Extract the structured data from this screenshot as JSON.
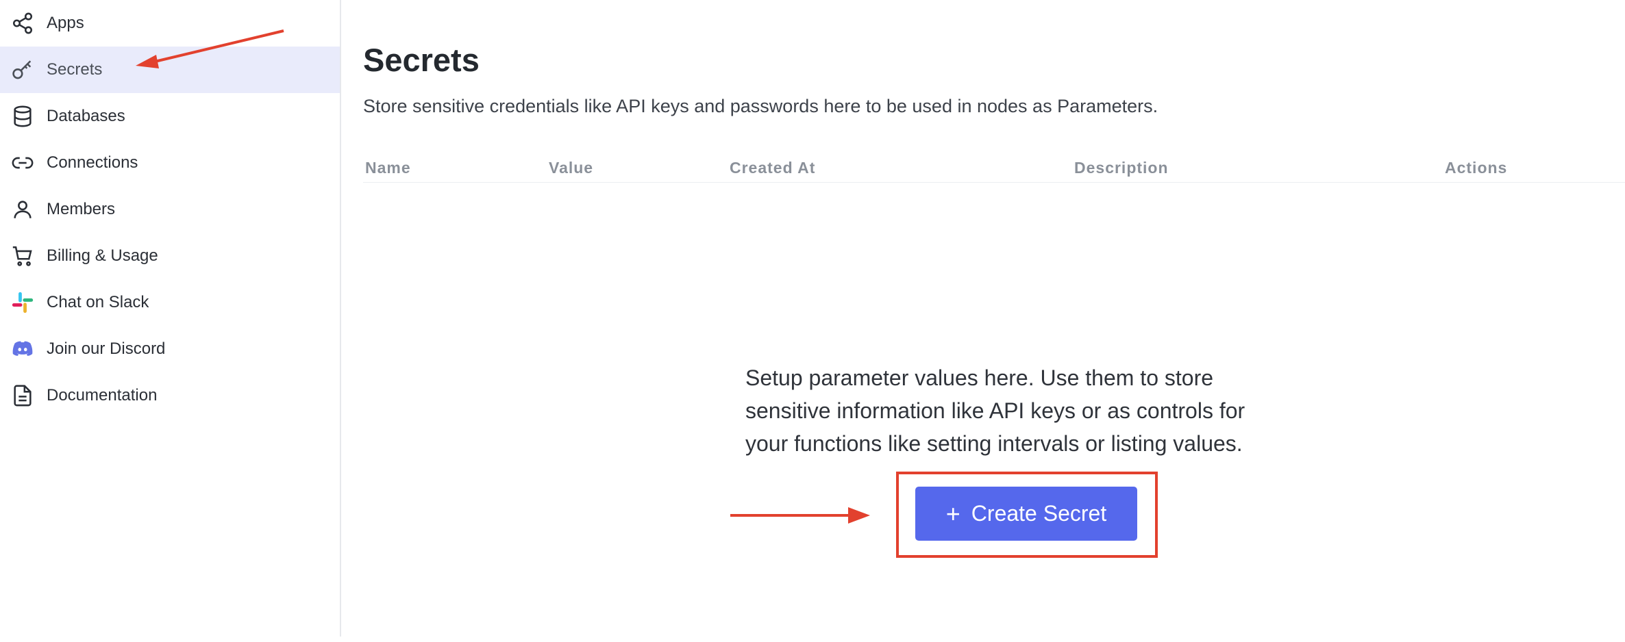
{
  "sidebar": {
    "items": [
      {
        "label": "Apps",
        "icon": "share-nodes-icon"
      },
      {
        "label": "Secrets",
        "icon": "key-icon",
        "active": true
      },
      {
        "label": "Databases",
        "icon": "database-icon"
      },
      {
        "label": "Connections",
        "icon": "link-icon"
      },
      {
        "label": "Members",
        "icon": "user-icon"
      },
      {
        "label": "Billing & Usage",
        "icon": "cart-icon"
      },
      {
        "label": "Chat on Slack",
        "icon": "slack-icon"
      },
      {
        "label": "Join our Discord",
        "icon": "discord-icon"
      },
      {
        "label": "Documentation",
        "icon": "document-icon"
      }
    ]
  },
  "main": {
    "title": "Secrets",
    "subtitle": "Store sensitive credentials like API keys and passwords here to be used in nodes as Parameters.",
    "table": {
      "columns": [
        "Name",
        "Value",
        "Created At",
        "Description",
        "Actions"
      ],
      "rows": []
    },
    "empty_state": {
      "text": "Setup parameter values here. Use them to store sensitive information like API keys or as controls for your functions like setting intervals or listing values.",
      "button_label": "Create Secret",
      "button_icon": "plus-icon"
    }
  },
  "colors": {
    "accent": "#5568ec",
    "active_nav_bg": "#e9ebfb",
    "annotation": "#e2412e"
  }
}
